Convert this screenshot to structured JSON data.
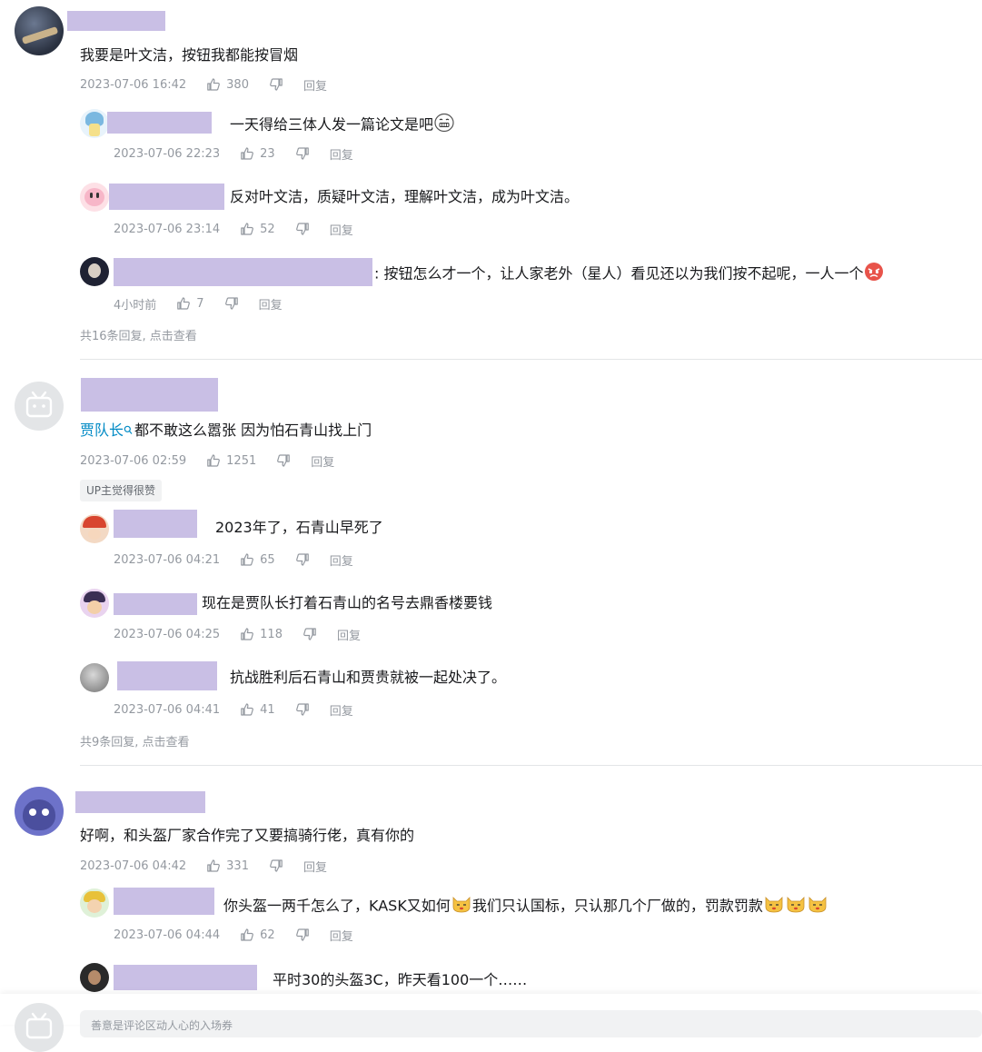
{
  "threads": [
    {
      "text": "我要是叶文洁，按钮我都能按冒烟",
      "time": "2023-07-06 16:42",
      "likes": "380",
      "reply_label": "回复",
      "replies": [
        {
          "text": "一天得给三体人发一篇论文是吧",
          "time": "2023-07-06 22:23",
          "likes": "23",
          "reply_label": "回复"
        },
        {
          "text": "反对叶文洁，质疑叶文洁，理解叶文洁，成为叶文洁。",
          "time": "2023-07-06 23:14",
          "likes": "52",
          "reply_label": "回复"
        },
        {
          "text": ": 按钮怎么才一个，让人家老外（星人）看见还以为我们按不起呢，一人一个",
          "time": "4小时前",
          "likes": "7",
          "reply_label": "回复"
        }
      ],
      "more": "共16条回复, 点击查看"
    },
    {
      "link": "贾队长",
      "text": "都不敢这么嚣张 因为怕石青山找上门",
      "time": "2023-07-06 02:59",
      "likes": "1251",
      "reply_label": "回复",
      "badge": "UP主觉得很赞",
      "replies": [
        {
          "text": "2023年了，石青山早死了",
          "time": "2023-07-06 04:21",
          "likes": "65",
          "reply_label": "回复"
        },
        {
          "text": "现在是贾队长打着石青山的名号去鼎香楼要钱",
          "time": "2023-07-06 04:25",
          "likes": "118",
          "reply_label": "回复"
        },
        {
          "text": "抗战胜利后石青山和贾贵就被一起处决了。",
          "time": "2023-07-06 04:41",
          "likes": "41",
          "reply_label": "回复"
        }
      ],
      "more": "共9条回复, 点击查看"
    },
    {
      "text": "好啊，和头盔厂家合作完了又要搞骑行佬，真有你的",
      "time": "2023-07-06 04:42",
      "likes": "331",
      "reply_label": "回复",
      "replies": [
        {
          "text_a": "你头盔一两千怎么了，KASK又如何",
          "text_b": "我们只认国标，只认那几个厂做的，罚款罚款",
          "time": "2023-07-06 04:44",
          "likes": "62",
          "reply_label": "回复"
        },
        {
          "text": "平时30的头盔3C，昨天看100一个……"
        }
      ]
    }
  ],
  "bottom": {
    "placeholder": "善意是评论区动人心的入场券"
  },
  "colors": {
    "link": "#008ac5",
    "meta": "#9499a0",
    "redact": "#c9bfe5",
    "divider": "#e3e5e7"
  }
}
